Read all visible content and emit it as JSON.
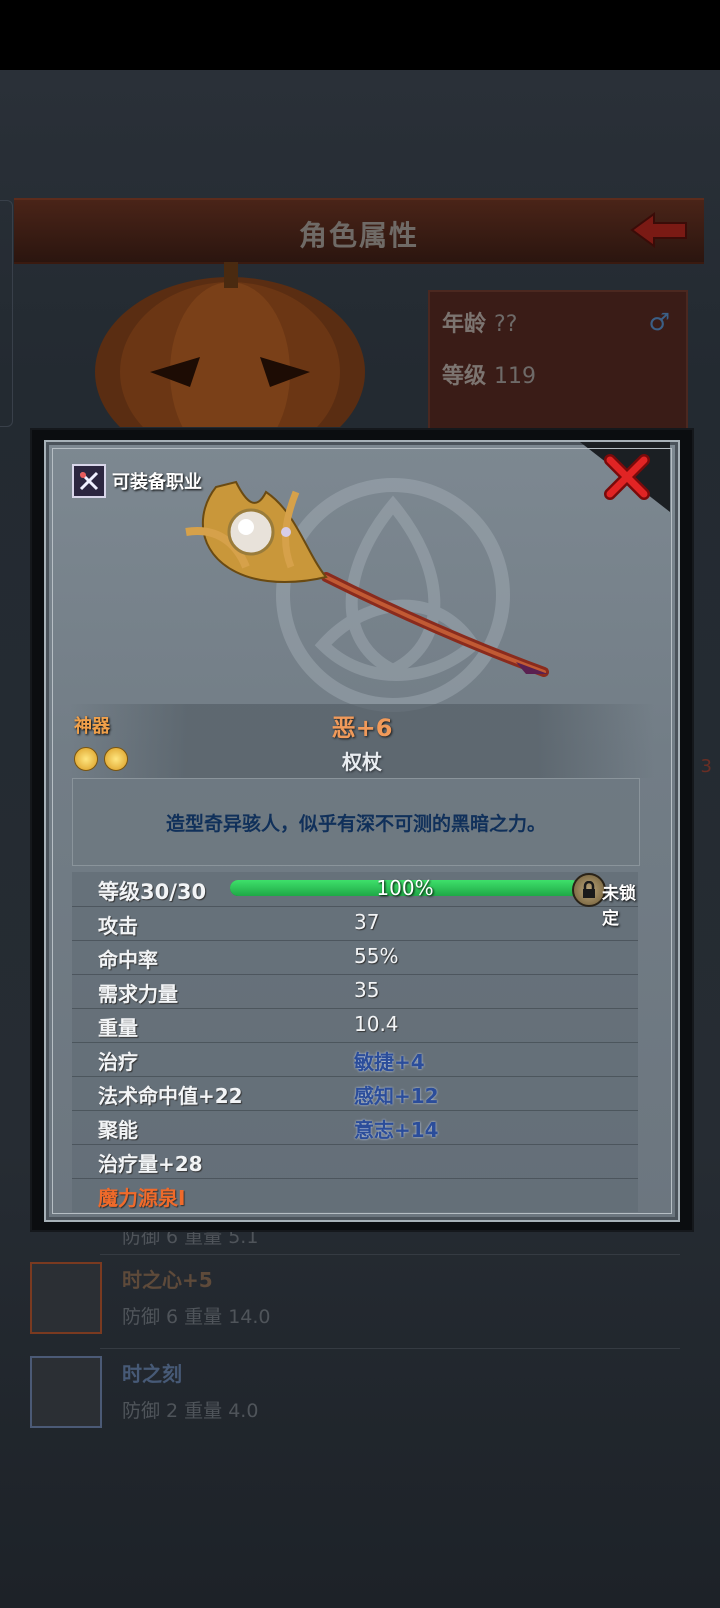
{
  "background": {
    "title": "角色属性",
    "info": {
      "age_label": "年龄",
      "age_value": "??",
      "level_label": "等级",
      "level_value": "119"
    },
    "side_number": "3",
    "list": [
      {
        "name": "",
        "stat": "防御 6 重量 5.1"
      },
      {
        "name": "时之心+5",
        "stat": "防御 6 重量 14.0"
      },
      {
        "name": "时之刻",
        "stat": "防御 2 重量 4.0"
      }
    ]
  },
  "item": {
    "job_label": "可装备职业",
    "rarity": "神器",
    "name": "恶+6",
    "type": "权杖",
    "star_count": 2,
    "description": "造型奇异骇人，似乎有深不可测的黑暗之力。",
    "level_label": "等级30/30",
    "xp_percent_text": "100%",
    "xp_fraction": 1.0,
    "lock_text": "未锁定",
    "stats": [
      {
        "label": "攻击",
        "value": "37"
      },
      {
        "label": "命中率",
        "value": "55%"
      },
      {
        "label": "需求力量",
        "value": "35"
      },
      {
        "label": "重量",
        "value": "10.4"
      },
      {
        "label": "治疗",
        "value": "敏捷+4"
      },
      {
        "label": "法术命中值+22",
        "value": "感知+12"
      },
      {
        "label": "聚能",
        "value": "意志+14"
      },
      {
        "label": "治疗量+28",
        "value": ""
      },
      {
        "label": "魔力源泉I",
        "value": ""
      }
    ]
  },
  "colors": {
    "accent_orange": "#f19a5a",
    "xp_green": "#2fcf5a",
    "close_red": "#d81e1e"
  }
}
